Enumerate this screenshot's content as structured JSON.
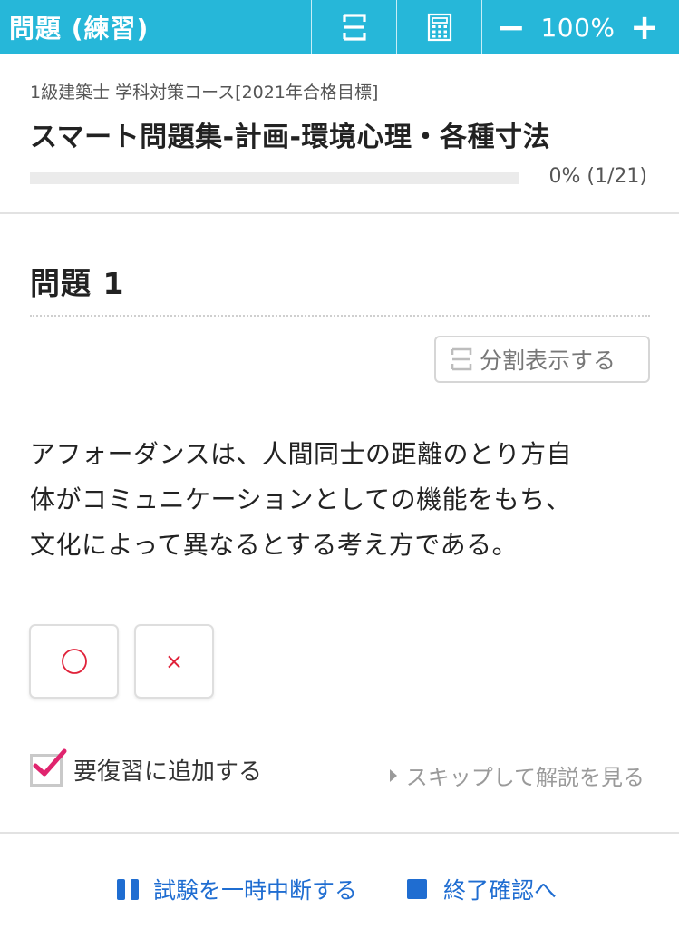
{
  "topbar": {
    "title": "問題 (練習)",
    "zoom_minus": "−",
    "zoom_level": "100%",
    "zoom_plus": "+"
  },
  "header": {
    "course": "1級建築士 学科対策コース[2021年合格目標]",
    "set_title": "スマート問題集-計画-環境心理・各種寸法",
    "progress_text": "0% (1/21)",
    "progress_percent": 0
  },
  "question": {
    "heading": "問題 1",
    "split_label": "分割表示する",
    "lines": [
      "アフォーダンスは、人間同士の距離のとり方自",
      "体がコミュニケーションとしての機能をもち、",
      "文化によって異なるとする考え方である。"
    ],
    "answer_false": "×"
  },
  "controls": {
    "review_label": "要復習に追加する",
    "review_checked": true,
    "skip_label": "スキップして解説を見る"
  },
  "footer": {
    "pause_label": "試験を一時中断する",
    "finish_label": "終了確認へ"
  },
  "colors": {
    "accent": "#26b7d9",
    "answer_red": "#e0223a",
    "check_pink": "#e0246e",
    "link_blue": "#1f6dd1"
  },
  "icons": {
    "split": "split-view-icon",
    "calculator": "calculator-icon",
    "pause": "pause-icon",
    "stop": "stop-icon",
    "skip": "triangle-right-icon",
    "answer_true": "circle-icon"
  }
}
